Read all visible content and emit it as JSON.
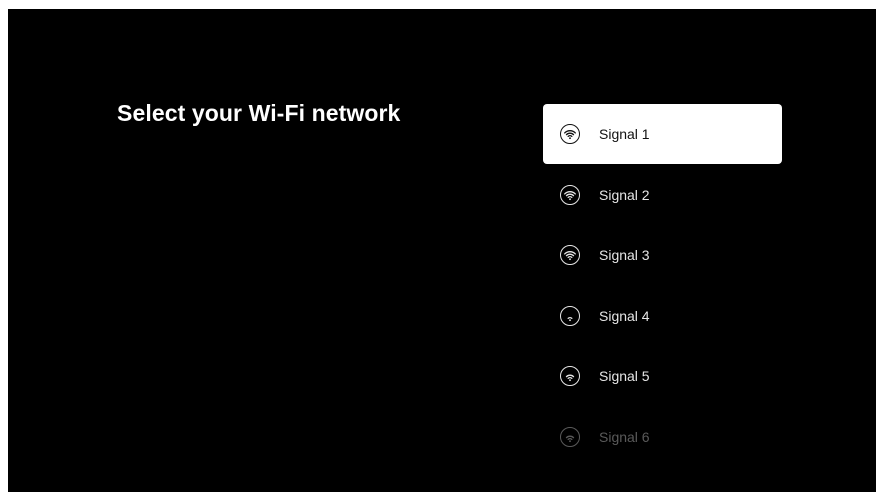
{
  "header": {
    "title": "Select your Wi-Fi network"
  },
  "networks": [
    {
      "label": "Signal 1",
      "icon": "wifi-strength-3-icon",
      "signal_bars": 3,
      "state": "selected"
    },
    {
      "label": "Signal 2",
      "icon": "wifi-strength-3-icon",
      "signal_bars": 3,
      "state": "normal"
    },
    {
      "label": "Signal 3",
      "icon": "wifi-strength-3-icon",
      "signal_bars": 3,
      "state": "normal"
    },
    {
      "label": "Signal 4",
      "icon": "wifi-strength-1-icon",
      "signal_bars": 1,
      "state": "normal"
    },
    {
      "label": "Signal 5",
      "icon": "wifi-strength-2-icon",
      "signal_bars": 2,
      "state": "normal"
    },
    {
      "label": "Signal 6",
      "icon": "wifi-strength-2-icon",
      "signal_bars": 2,
      "state": "faded"
    }
  ],
  "colors": {
    "background": "#000000",
    "text": "#ffffff",
    "selected_background": "#ffffff",
    "selected_text": "#111111",
    "faded_text": "#5a5a5a"
  }
}
